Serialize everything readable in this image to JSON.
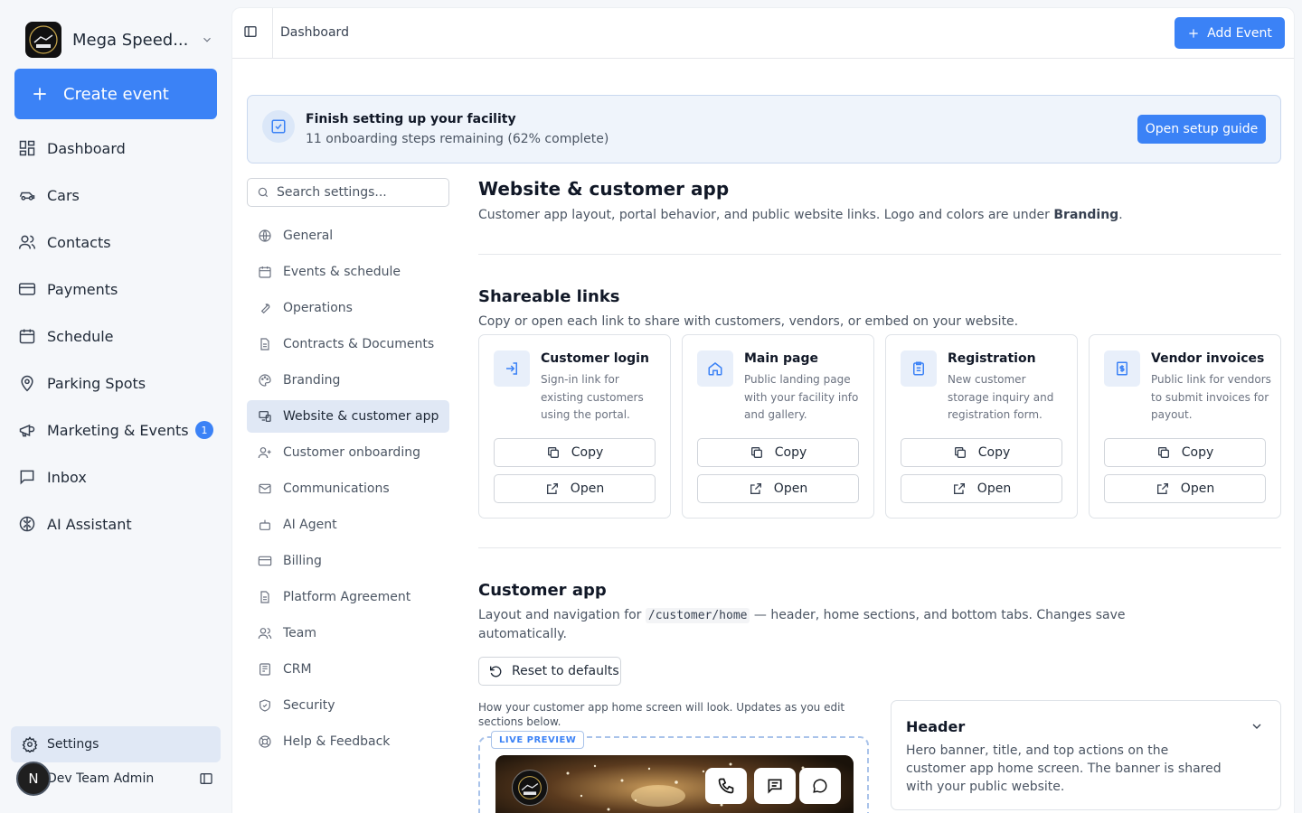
{
  "sidebar": {
    "brand_name": "Mega Speed...",
    "create_label": "Create event",
    "items": [
      {
        "label": "Dashboard"
      },
      {
        "label": "Cars"
      },
      {
        "label": "Contacts"
      },
      {
        "label": "Payments"
      },
      {
        "label": "Schedule"
      },
      {
        "label": "Parking Spots"
      },
      {
        "label": "Marketing & Events",
        "badge": "1"
      },
      {
        "label": "Inbox"
      },
      {
        "label": "AI Assistant"
      }
    ],
    "settings_label": "Settings",
    "user": {
      "initial": "N",
      "name": "Dev Team Admin"
    }
  },
  "topbar": {
    "breadcrumb": "Dashboard",
    "add_event_label": "Add Event"
  },
  "setup_banner": {
    "title": "Finish setting up your facility",
    "subtitle": "11 onboarding steps remaining (62% complete)",
    "button_label": "Open setup guide"
  },
  "settings_nav": {
    "search_placeholder": "Search settings...",
    "items": [
      {
        "label": "General"
      },
      {
        "label": "Events & schedule"
      },
      {
        "label": "Operations"
      },
      {
        "label": "Contracts & Documents"
      },
      {
        "label": "Branding"
      },
      {
        "label": "Website & customer app"
      },
      {
        "label": "Customer onboarding"
      },
      {
        "label": "Communications"
      },
      {
        "label": "AI Agent"
      },
      {
        "label": "Billing"
      },
      {
        "label": "Platform Agreement"
      },
      {
        "label": "Team"
      },
      {
        "label": "CRM"
      },
      {
        "label": "Security"
      },
      {
        "label": "Help & Feedback"
      }
    ],
    "active": "Website & customer app"
  },
  "section": {
    "title": "Website & customer app",
    "desc_pre": "Customer app layout, portal behavior, and public website links. Logo and colors are under ",
    "desc_bold": "Branding",
    "desc_post": "."
  },
  "shareable": {
    "title": "Shareable links",
    "desc": "Copy or open each link to share with customers, vendors, or embed on your website.",
    "copy_label": "Copy",
    "open_label": "Open",
    "cards": [
      {
        "title": "Customer login",
        "desc": "Sign-in link for existing customers using the portal.",
        "icon": "login-icon"
      },
      {
        "title": "Main page",
        "desc": "Public landing page with your facility info and gallery.",
        "icon": "home-icon"
      },
      {
        "title": "Registration",
        "desc": "New customer storage inquiry and registration form.",
        "icon": "clipboard-icon"
      },
      {
        "title": "Vendor invoices",
        "desc": "Public link for vendors to submit invoices for payout.",
        "icon": "invoice-icon"
      }
    ]
  },
  "customer_app": {
    "title": "Customer app",
    "desc_pre": "Layout and navigation for ",
    "desc_code": "/customer/home",
    "desc_post": " — header, home sections, and bottom tabs. Changes save automatically.",
    "reset_label": "Reset to defaults",
    "preview_note": "How your customer app home screen will look. Updates as you edit sections below.",
    "live_preview_label": "LIVE PREVIEW",
    "header_card": {
      "title": "Header",
      "desc": "Hero banner, title, and top actions on the customer app home screen. The banner is shared with your public website."
    }
  },
  "colors": {
    "accent": "#3b82f6",
    "active_bg": "#e0e8f5",
    "banner_bg": "#eff4fb"
  }
}
